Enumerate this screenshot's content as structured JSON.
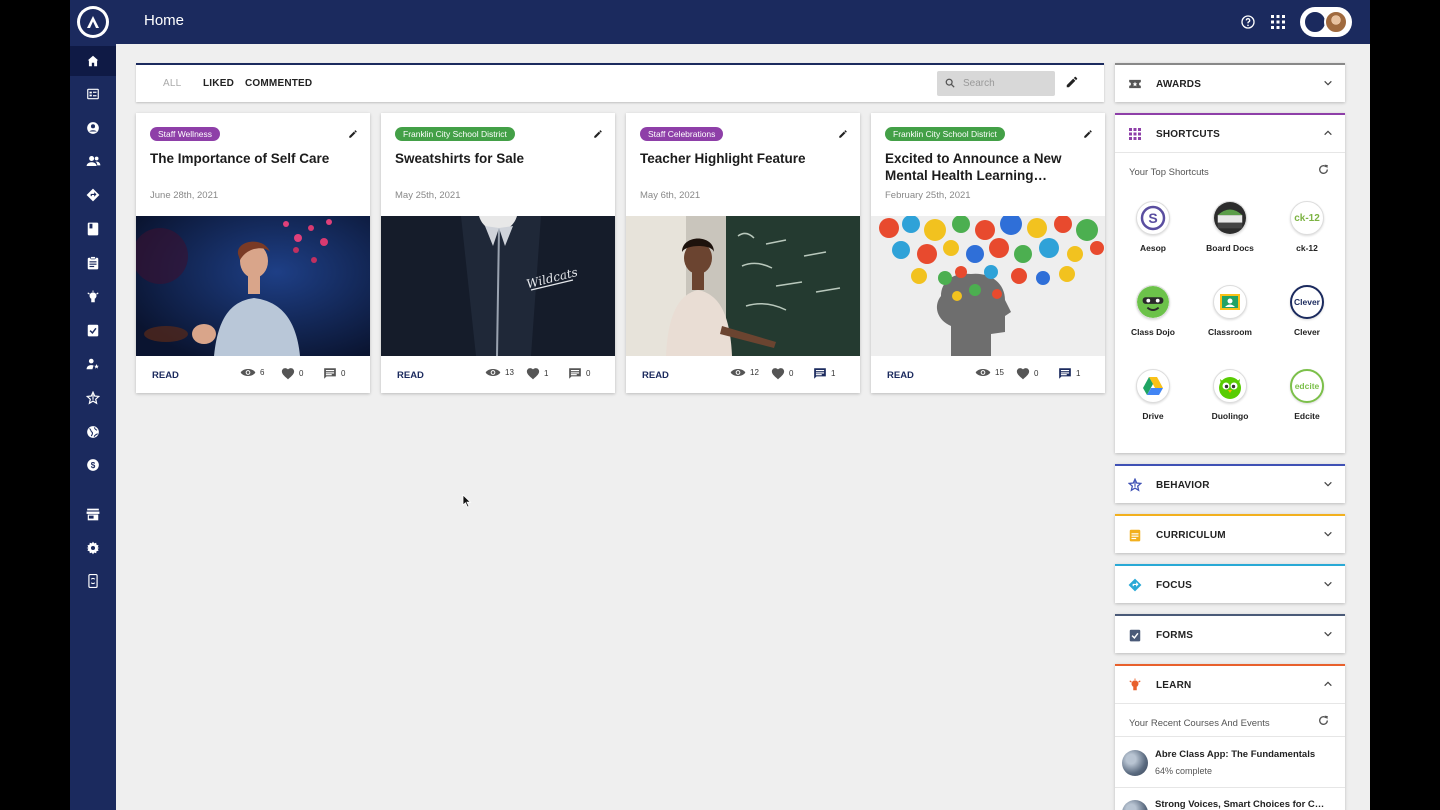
{
  "app": {
    "title": "Home",
    "brand_color": "#1b2a5e",
    "accent_color": "#0f1a45"
  },
  "topbar": {
    "help_icon": "help-circle-icon",
    "apps_icon": "apps-grid-icon"
  },
  "sidebar": {
    "items": [
      {
        "icon": "home-icon",
        "active": true
      },
      {
        "icon": "dashboard-list-icon"
      },
      {
        "icon": "account-circle-icon"
      },
      {
        "icon": "people-icon"
      },
      {
        "icon": "directions-diamond-icon"
      },
      {
        "icon": "book-icon"
      },
      {
        "icon": "clipboard-icon"
      },
      {
        "icon": "lightbulb-icon"
      },
      {
        "icon": "assignment-check-icon"
      },
      {
        "icon": "person-star-icon"
      },
      {
        "icon": "star-outline-icon"
      },
      {
        "icon": "globe-icon"
      },
      {
        "icon": "dollar-icon"
      },
      {
        "icon": "store-icon"
      },
      {
        "icon": "settings-gear-icon"
      },
      {
        "icon": "phone-rotate-icon"
      }
    ]
  },
  "feed": {
    "filters": [
      "ALL",
      "LIKED",
      "COMMENTED"
    ],
    "search_placeholder": "Search",
    "cards": [
      {
        "tag": "Staff Wellness",
        "tag_color": "#8e3fa8",
        "title": "The Importance of Self Care",
        "date": "June 28th, 2021",
        "read": "READ",
        "views": "6",
        "likes": "0",
        "comments": "0",
        "commented": false
      },
      {
        "tag": "Franklin City School District",
        "tag_color": "#43a047",
        "title": "Sweatshirts for Sale",
        "date": "May 25th, 2021",
        "read": "READ",
        "views": "13",
        "likes": "1",
        "comments": "0",
        "commented": false
      },
      {
        "tag": "Staff Celebrations",
        "tag_color": "#8e3fa8",
        "title": "Teacher Highlight Feature",
        "date": "May 6th, 2021",
        "read": "READ",
        "views": "12",
        "likes": "0",
        "comments": "1",
        "commented": true
      },
      {
        "tag": "Franklin City School District",
        "tag_color": "#43a047",
        "title": "Excited to Announce a New Mental Health Learning…",
        "date": "February 25th, 2021",
        "read": "READ",
        "views": "15",
        "likes": "0",
        "comments": "1",
        "commented": true
      }
    ]
  },
  "panels": {
    "awards": {
      "label": "AWARDS",
      "color": "#888888"
    },
    "shortcuts": {
      "label": "SHORTCUTS",
      "color": "#8e3fa8",
      "subtitle": "Your Top Shortcuts",
      "items": [
        {
          "label": "Aesop",
          "glyph": "S"
        },
        {
          "label": "Board Docs",
          "glyph": ""
        },
        {
          "label": "ck-12",
          "glyph": "ck-12"
        },
        {
          "label": "Class Dojo",
          "glyph": ""
        },
        {
          "label": "Classroom",
          "glyph": ""
        },
        {
          "label": "Clever",
          "glyph": "Clever"
        },
        {
          "label": "Drive",
          "glyph": ""
        },
        {
          "label": "Duolingo",
          "glyph": ""
        },
        {
          "label": "Edcite",
          "glyph": "edcite"
        }
      ]
    },
    "behavior": {
      "label": "BEHAVIOR",
      "color": "#3f51b5"
    },
    "curriculum": {
      "label": "CURRICULUM",
      "color": "#f2b01e"
    },
    "focus": {
      "label": "FOCUS",
      "color": "#29a9d6"
    },
    "forms": {
      "label": "FORMS",
      "color": "#4a5a78"
    },
    "learn": {
      "label": "LEARN",
      "color": "#e8602c",
      "subtitle": "Your Recent Courses And Events",
      "courses": [
        {
          "title": "Abre Class App: The Fundamentals",
          "progress": "64% complete",
          "progress_value": 0.64
        },
        {
          "title": "Strong Voices, Smart Choices for C…",
          "progress": ""
        }
      ]
    }
  }
}
